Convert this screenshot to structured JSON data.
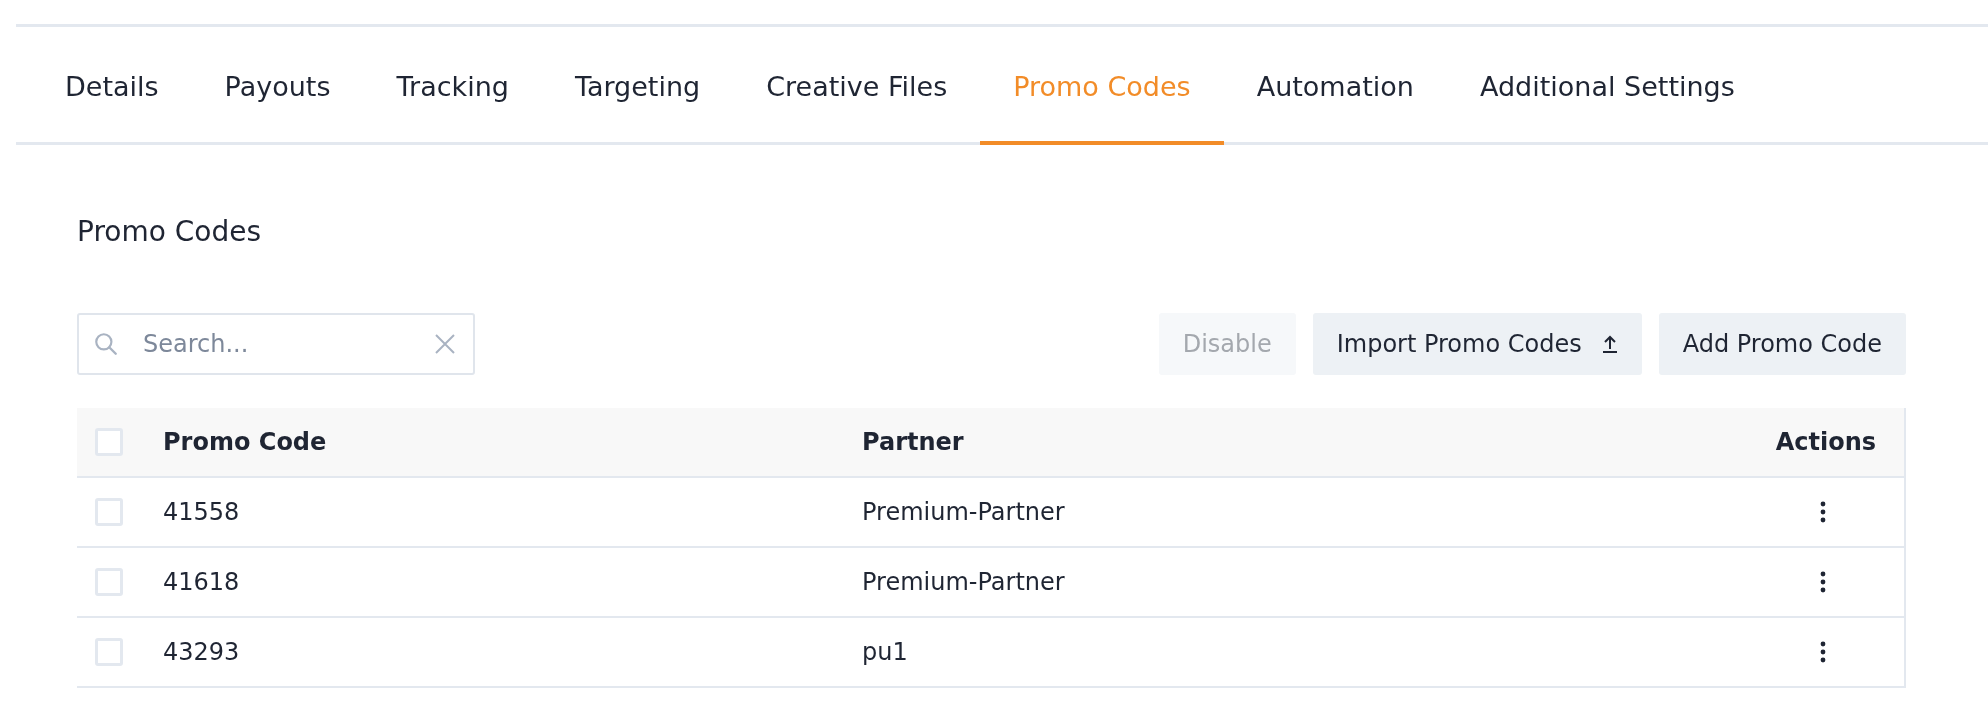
{
  "tabs": [
    {
      "label": "Details",
      "selected": false
    },
    {
      "label": "Payouts",
      "selected": false
    },
    {
      "label": "Tracking",
      "selected": false
    },
    {
      "label": "Targeting",
      "selected": false
    },
    {
      "label": "Creative Files",
      "selected": false
    },
    {
      "label": "Promo Codes",
      "selected": true
    },
    {
      "label": "Automation",
      "selected": false
    },
    {
      "label": "Additional Settings",
      "selected": false
    }
  ],
  "heading": "Promo Codes",
  "search": {
    "placeholder": "Search..."
  },
  "buttons": [
    {
      "label": "Disable",
      "disabled": true,
      "kind": "plain"
    },
    {
      "label": "Import Promo Codes",
      "disabled": false,
      "kind": "upload"
    },
    {
      "label": "Add Promo Code",
      "disabled": false,
      "kind": "plain"
    }
  ],
  "table": {
    "header_checked": false,
    "columns": [
      "Promo Code",
      "Partner",
      "Actions"
    ],
    "rows": [
      {
        "promo_code": "41558",
        "partner": "Premium-Partner",
        "checked": false
      },
      {
        "promo_code": "41618",
        "partner": "Premium-Partner",
        "checked": false
      },
      {
        "promo_code": "43293",
        "partner": "pu1",
        "checked": false
      }
    ]
  }
}
